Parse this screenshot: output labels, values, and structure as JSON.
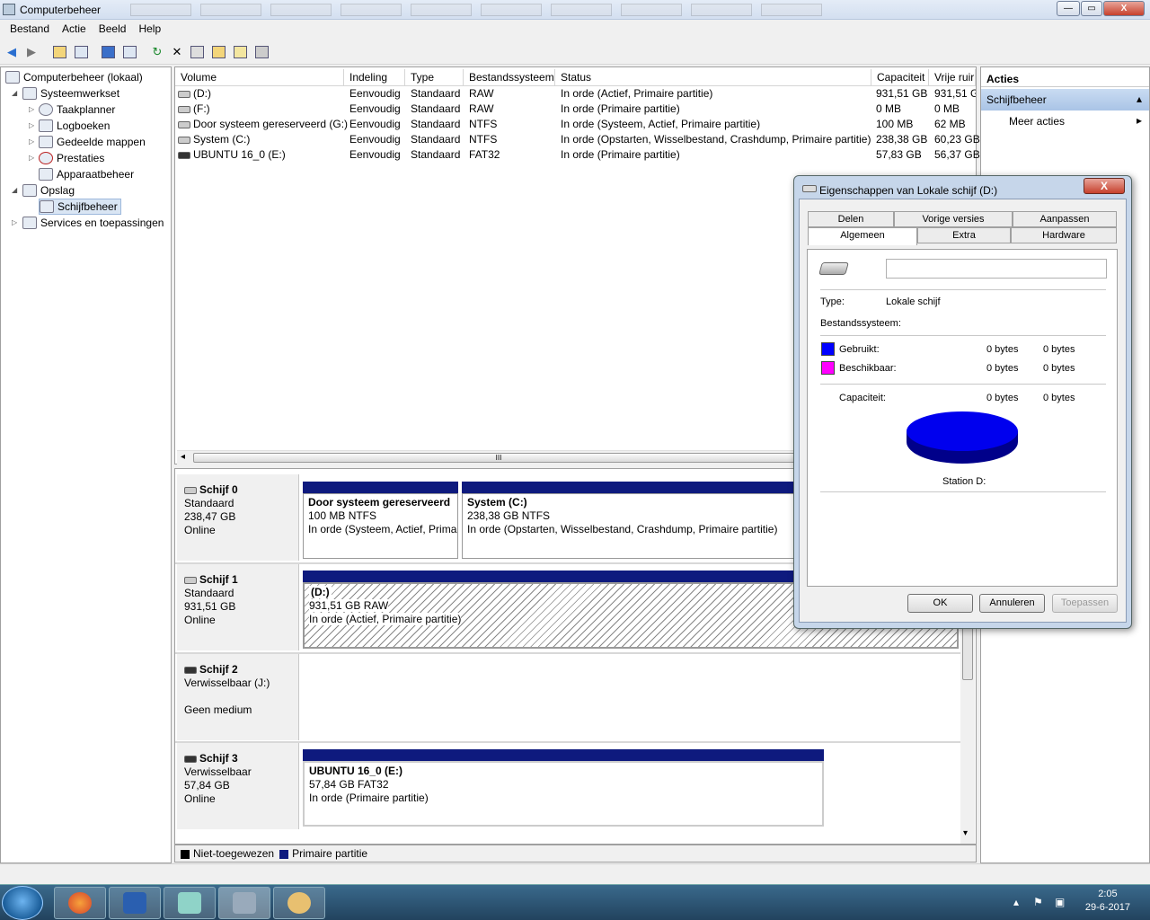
{
  "window": {
    "title": "Computerbeheer",
    "minimize": "—",
    "maximize": "▭",
    "close": "X"
  },
  "menu": [
    "Bestand",
    "Actie",
    "Beeld",
    "Help"
  ],
  "tree": {
    "root": "Computerbeheer (lokaal)",
    "systeemwerkset": "Systeemwerkset",
    "taakplanner": "Taakplanner",
    "logboeken": "Logboeken",
    "gedeelde_mappen": "Gedeelde mappen",
    "prestaties": "Prestaties",
    "apparaatbeheer": "Apparaatbeheer",
    "opslag": "Opslag",
    "schijfbeheer": "Schijfbeheer",
    "services": "Services en toepassingen"
  },
  "volumes": {
    "headers": {
      "volume": "Volume",
      "indeling": "Indeling",
      "type": "Type",
      "bestandssysteem": "Bestandssysteem",
      "status": "Status",
      "capaciteit": "Capaciteit",
      "vrije_ruimte": "Vrije ruir"
    },
    "rows": [
      {
        "volume": "(D:)",
        "indeling": "Eenvoudig",
        "type": "Standaard",
        "fs": "RAW",
        "status": "In orde (Actief, Primaire partitie)",
        "cap": "931,51 GB",
        "free": "931,51 G"
      },
      {
        "volume": "(F:)",
        "indeling": "Eenvoudig",
        "type": "Standaard",
        "fs": "RAW",
        "status": "In orde (Primaire partitie)",
        "cap": "0 MB",
        "free": "0 MB"
      },
      {
        "volume": "Door systeem gereserveerd (G:)",
        "indeling": "Eenvoudig",
        "type": "Standaard",
        "fs": "NTFS",
        "status": "In orde (Systeem, Actief, Primaire partitie)",
        "cap": "100 MB",
        "free": "62 MB"
      },
      {
        "volume": "System (C:)",
        "indeling": "Eenvoudig",
        "type": "Standaard",
        "fs": "NTFS",
        "status": "In orde (Opstarten, Wisselbestand, Crashdump, Primaire partitie)",
        "cap": "238,38 GB",
        "free": "60,23 GB"
      },
      {
        "volume": "UBUNTU 16_0 (E:)",
        "indeling": "Eenvoudig",
        "type": "Standaard",
        "fs": "FAT32",
        "status": "In orde (Primaire partitie)",
        "cap": "57,83 GB",
        "free": "56,37 GB"
      }
    ],
    "scroll_grip": "III",
    "scroll_left": "◂"
  },
  "disks": {
    "d0": {
      "name": "Schijf 0",
      "type": "Standaard",
      "size": "238,47 GB",
      "state": "Online",
      "p1": {
        "name": "Door systeem gereserveerd",
        "size": "100 MB NTFS",
        "status": "In orde (Systeem, Actief, Prima"
      },
      "p2": {
        "name": "System  (C:)",
        "size": "238,38 GB NTFS",
        "status": "In orde (Opstarten, Wisselbestand, Crashdump, Primaire partitie)"
      }
    },
    "d1": {
      "name": "Schijf 1",
      "type": "Standaard",
      "size": "931,51 GB",
      "state": "Online",
      "p1": {
        "name": "(D:)",
        "size": "931,51 GB RAW",
        "status": "In orde (Actief, Primaire partitie)"
      }
    },
    "d2": {
      "name": "Schijf 2",
      "type": "Verwisselbaar (J:)",
      "state": "Geen medium"
    },
    "d3": {
      "name": "Schijf 3",
      "type": "Verwisselbaar",
      "size": "57,84 GB",
      "state": "Online",
      "p1": {
        "name": "UBUNTU 16_0  (E:)",
        "size": "57,84 GB FAT32",
        "status": "In orde (Primaire partitie)"
      }
    },
    "scroll_down": "▾"
  },
  "legend": {
    "unallocated": "Niet-toegewezen",
    "primary": "Primaire partitie"
  },
  "actions": {
    "header": "Acties",
    "selected": "Schijfbeheer",
    "more": "Meer acties",
    "collapse": "▴",
    "expand": "▸"
  },
  "dialog": {
    "title": "Eigenschappen van Lokale schijf (D:)",
    "close": "X",
    "tabs_back": [
      "Delen",
      "Vorige versies",
      "Aanpassen"
    ],
    "tabs_front": [
      "Algemeen",
      "Extra",
      "Hardware"
    ],
    "name_value": "",
    "type_label": "Type:",
    "type_value": "Lokale schijf",
    "fs_label": "Bestandssysteem:",
    "used_label": "Gebruikt:",
    "used_bytes": "0 bytes",
    "used_size": "0 bytes",
    "free_label": "Beschikbaar:",
    "free_bytes": "0 bytes",
    "free_size": "0 bytes",
    "cap_label": "Capaciteit:",
    "cap_bytes": "0 bytes",
    "cap_size": "0 bytes",
    "station": "Station D:",
    "ok": "OK",
    "cancel": "Annuleren",
    "apply": "Toepassen"
  },
  "colors": {
    "primary_partition": "#0e1a7e",
    "unallocated": "#000000",
    "used": "#0000ff",
    "free": "#ff00ff",
    "pie": "#0000ee"
  },
  "taskbar": {
    "time": "2:05",
    "date": "29-6-2017",
    "tray_arrow": "▴"
  }
}
